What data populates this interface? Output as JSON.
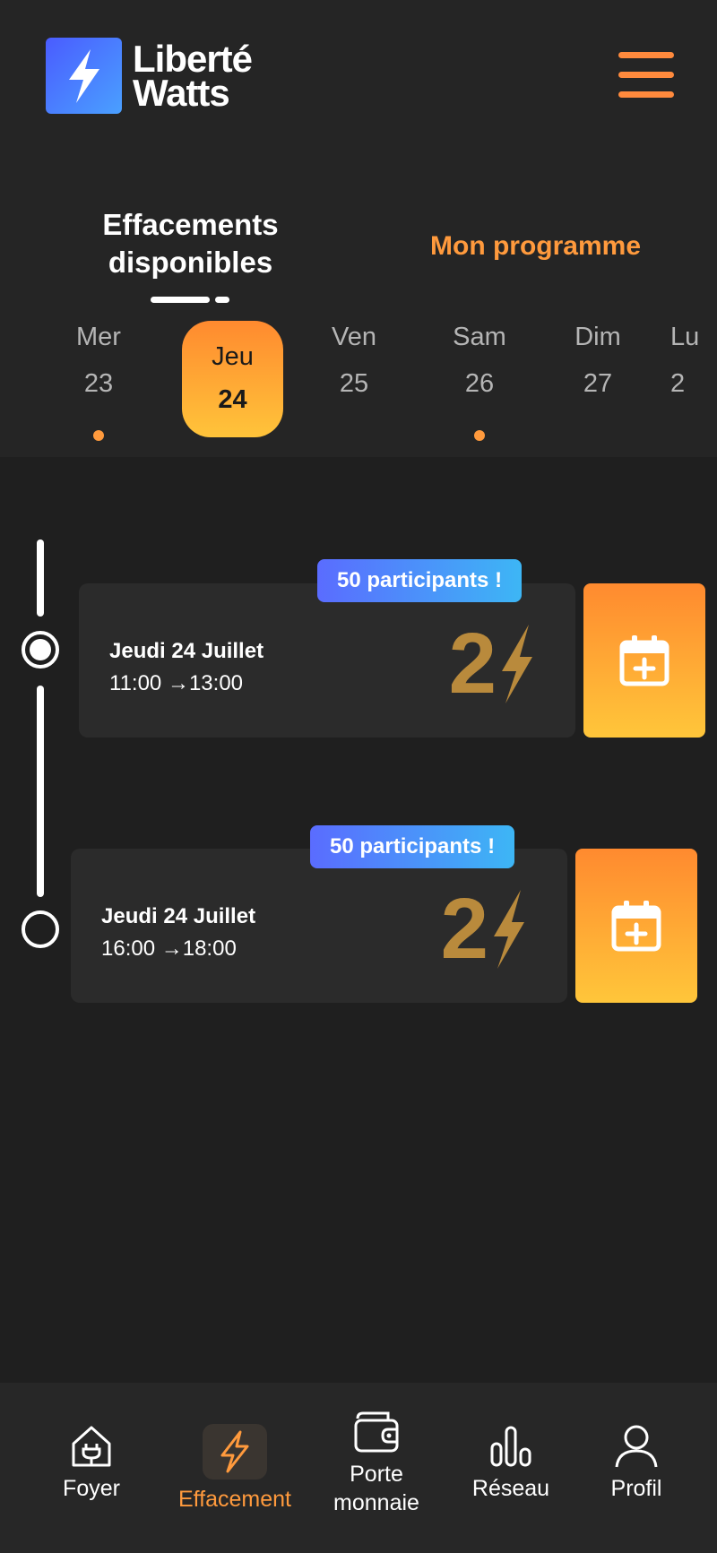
{
  "brand": {
    "line1": "Liberté",
    "line2": "Watts"
  },
  "tabs": {
    "available": "Effacements disponibles",
    "program": "Mon programme"
  },
  "days": [
    {
      "name": "Mer",
      "num": "23",
      "dot": true
    },
    {
      "name": "Jeu",
      "num": "24",
      "selected": true
    },
    {
      "name": "Ven",
      "num": "25"
    },
    {
      "name": "Sam",
      "num": "26",
      "dot": true
    },
    {
      "name": "Dim",
      "num": "27"
    },
    {
      "name": "Lu",
      "num": "2"
    }
  ],
  "slots": [
    {
      "badge": "50 participants !",
      "date": "Jeudi 24 Juillet",
      "start": "11:00",
      "end": "13:00",
      "arrow": "→",
      "points": "2"
    },
    {
      "badge": "50 participants !",
      "date": "Jeudi 24 Juillet",
      "start": "16:00",
      "end": "18:00",
      "arrow": "→",
      "points": "2"
    }
  ],
  "nav": [
    {
      "label": "Foyer",
      "icon": "house-plug-icon"
    },
    {
      "label": "Effacement",
      "icon": "lightning-icon",
      "active": true
    },
    {
      "label": "Porte monnaie",
      "icon": "wallet-icon"
    },
    {
      "label": "Réseau",
      "icon": "bars-icon"
    },
    {
      "label": "Profil",
      "icon": "user-icon"
    }
  ],
  "colors": {
    "accent": "#ff9a3d",
    "background": "#1f1f1f",
    "card": "#2b2b2b",
    "points": "#b98a3c"
  }
}
